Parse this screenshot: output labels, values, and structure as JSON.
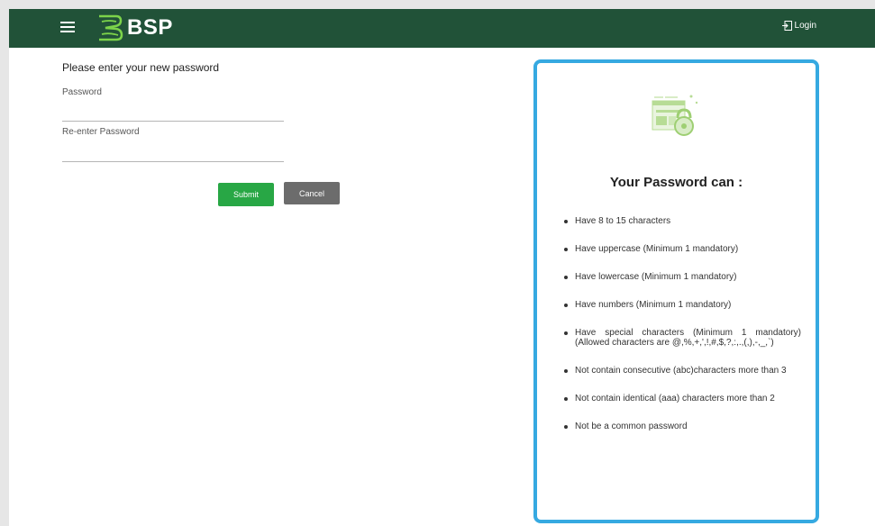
{
  "header": {
    "brand": "BSP",
    "login_label": "Login",
    "icons": {
      "menu": "hamburger-menu-icon",
      "login": "login-icon",
      "logo": "bsp-logo-icon"
    },
    "colors": {
      "background": "#215238",
      "text": "#ffffff"
    }
  },
  "form": {
    "title": "Please enter your new password",
    "password_label": "Password",
    "password_value": "",
    "reenter_label": "Re-enter Password",
    "reenter_value": "",
    "submit_label": "Submit",
    "cancel_label": "Cancel",
    "colors": {
      "submit": "#28a745",
      "cancel": "#6c6c6c"
    }
  },
  "rules_panel": {
    "icon": "password-lock-illustration-icon",
    "title": "Your Password can :",
    "border_color": "#36a9e1",
    "items": [
      "Have 8 to 15 characters",
      "Have uppercase (Minimum 1 mandatory)",
      "Have lowercase (Minimum 1 mandatory)",
      "Have numbers (Minimum 1 mandatory)",
      "Have special characters (Minimum 1 mandatory) (Allowed characters are @,%,+,',!,#,$,?,:,.,(,),-,_,`)",
      "Not contain consecutive (abc)characters more than 3",
      "Not contain identical (aaa) characters more than 2",
      "Not be a common password"
    ]
  }
}
